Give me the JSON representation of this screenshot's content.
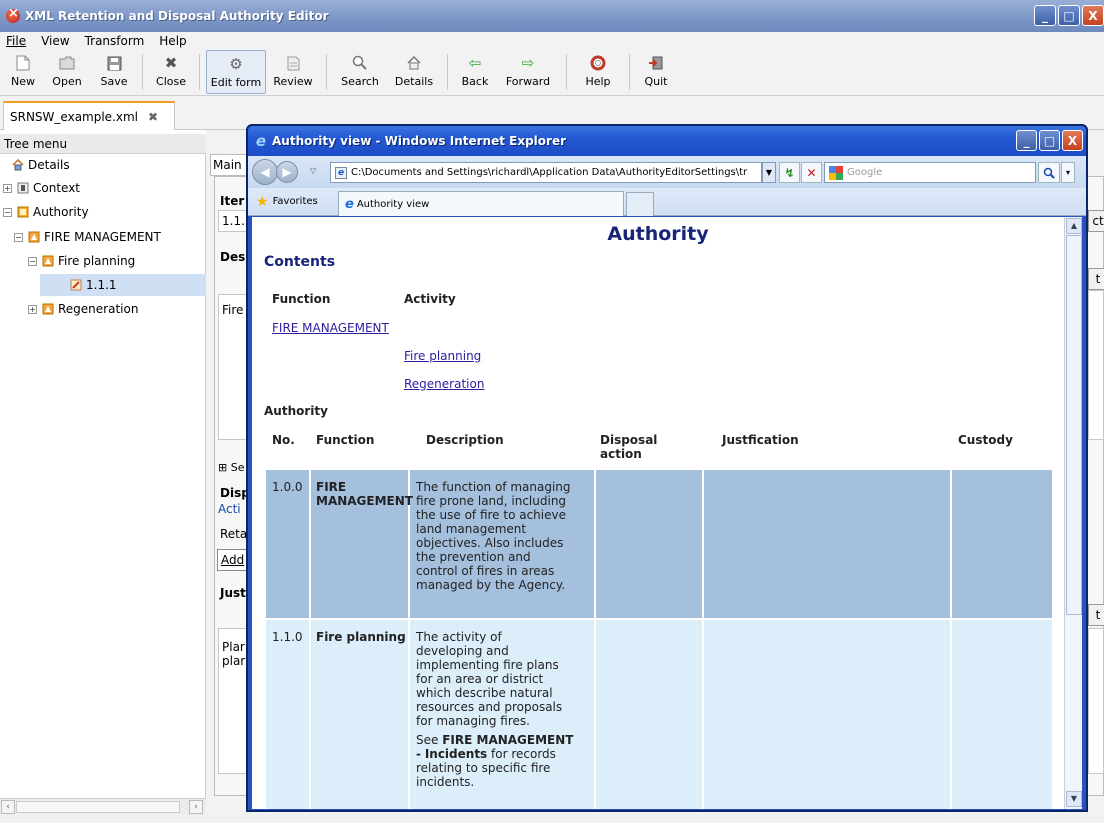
{
  "window": {
    "title": "XML Retention and Disposal Authority Editor",
    "controls": {
      "minimize": "_",
      "maximize": "□",
      "close": "X"
    }
  },
  "menu": [
    "File",
    "View",
    "Transform",
    "Help"
  ],
  "toolbar": {
    "new": "New",
    "open": "Open",
    "save": "Save",
    "close": "Close",
    "edit_form": "Edit form",
    "review": "Review",
    "search": "Search",
    "details": "Details",
    "back": "Back",
    "forward": "Forward",
    "help": "Help",
    "quit": "Quit"
  },
  "doc_tab": {
    "label": "SRNSW_example.xml"
  },
  "tree": {
    "header": "Tree menu",
    "items": [
      {
        "label": "Details"
      },
      {
        "label": "Context"
      },
      {
        "label": "Authority"
      },
      {
        "label": "FIRE MANAGEMENT"
      },
      {
        "label": "Fire planning"
      },
      {
        "label": "1.1.1"
      },
      {
        "label": "Regeneration"
      }
    ]
  },
  "form_peek": {
    "main_tab": "Main",
    "item": "Iter",
    "item_value": "1.1.",
    "desc": "Des",
    "desc_text": "Fire",
    "se": "Se",
    "disp": "Disp",
    "acti": "Acti",
    "reta": "Reta",
    "add": "Add",
    "just": "Just",
    "plan1": "Plar",
    "plan2": "plar",
    "btn1": "ct",
    "btn2": "t",
    "btn3": "t"
  },
  "ie": {
    "title": "Authority view - Windows Internet Explorer",
    "address": "C:\\Documents and Settings\\richardl\\Application Data\\AuthorityEditorSettings\\tr",
    "search_placeholder": "Google",
    "favorites": "Favorites",
    "tab_label": "Authority view"
  },
  "doc": {
    "title": "Authority",
    "contents_heading": "Contents",
    "contents_cols": {
      "function": "Function",
      "activity": "Activity"
    },
    "links": {
      "fire_management": "FIRE MANAGEMENT",
      "fire_planning": "Fire planning",
      "regeneration": "Regeneration"
    },
    "authority_heading": "Authority",
    "columns": {
      "no": "No.",
      "function": "Function",
      "description": "Description",
      "disposal_1": "Disposal",
      "disposal_2": "action",
      "justification": "Justfication",
      "custody": "Custody"
    },
    "rows": [
      {
        "no": "1.0.0",
        "function_lines": [
          "FIRE",
          "MANAGEMENT"
        ],
        "description_lines": [
          "The function of managing",
          "fire prone land, including",
          "the use of fire to achieve",
          "land management",
          "objectives. Also includes",
          "the prevention and",
          "control of fires in areas",
          "managed by the Agency."
        ]
      },
      {
        "no": "1.1.0",
        "function": "Fire planning",
        "description_lines": [
          "The activity of",
          "developing and",
          "implementing fire plans",
          "for an area or district",
          "which describe natural",
          "resources and proposals",
          "for managing fires."
        ],
        "see_prefix": "See",
        "see_bold_1": "FIRE MANAGEMENT",
        "see_dash": "-",
        "see_bold_2": "Incidents",
        "see_rest_1": " for records",
        "see_rest_lines": [
          "relating to specific fire",
          "incidents."
        ]
      }
    ]
  }
}
